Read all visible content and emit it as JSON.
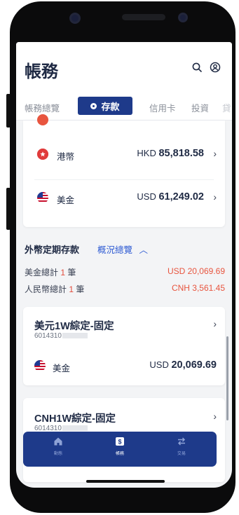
{
  "header": {
    "title": "帳務"
  },
  "tabs": [
    {
      "label": "帳務總覽"
    },
    {
      "label": "存款",
      "active": true
    },
    {
      "label": "信用卡"
    },
    {
      "label": "投資"
    }
  ],
  "currency_balances": [
    {
      "name": "港幣",
      "currency": "HKD",
      "amount": "85,818.58",
      "icon": "hk-flag-icon"
    },
    {
      "name": "美金",
      "currency": "USD",
      "amount": "61,249.02",
      "icon": "us-flag-icon"
    }
  ],
  "time_deposits": {
    "title": "外幣定期存款",
    "overview_link": "概況總覽",
    "summaries": [
      {
        "label_prefix": "美金總計",
        "count": "1",
        "label_suffix": "筆",
        "value": "USD 20,069.69"
      },
      {
        "label_prefix": "人民幣總計",
        "count": "1",
        "label_suffix": "筆",
        "value": "CNH 3,561.45"
      }
    ],
    "accounts": [
      {
        "title": "美元1W綜定-固定",
        "account": "6014310",
        "currency_name": "美金",
        "currency": "USD",
        "amount": "20,069.69"
      },
      {
        "title": "CNH1W綜定-固定",
        "account": "6014310"
      }
    ]
  },
  "bottom_nav": [
    {
      "label": "動態",
      "icon": "home-icon"
    },
    {
      "label": "帳務",
      "icon": "dollar-icon",
      "active": true
    },
    {
      "label": "交易",
      "icon": "transfer-icon"
    }
  ],
  "colors": {
    "brand": "#1e3a8a",
    "accent_red": "#e8553f",
    "link": "#2f5bd3"
  }
}
